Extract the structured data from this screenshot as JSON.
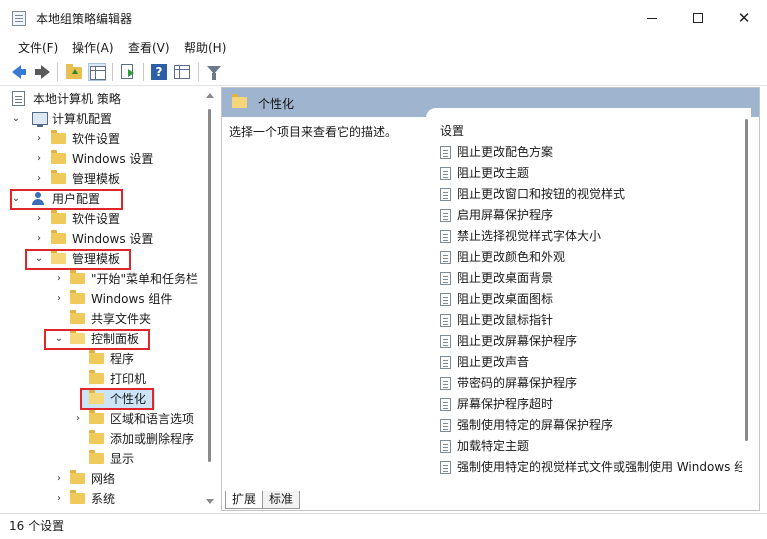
{
  "window": {
    "title": "本地组策略编辑器",
    "minimize_glyph": "—",
    "maximize_glyph": "□",
    "close_glyph": "✕"
  },
  "menu": {
    "items": [
      "文件(F)",
      "操作(A)",
      "查看(V)",
      "帮助(H)"
    ]
  },
  "toolbar": {
    "icons": [
      "back-icon",
      "forward-icon",
      "up-folder-icon",
      "show-hide-tree-icon",
      "export-list-icon",
      "help-icon",
      "properties-icon",
      "filter-icon"
    ]
  },
  "tree": {
    "root": "本地计算机 策略",
    "computer_config": "计算机配置",
    "c_software": "软件设置",
    "c_windows": "Windows 设置",
    "c_admin": "管理模板",
    "user_config": "用户配置",
    "u_software": "软件设置",
    "u_windows": "Windows 设置",
    "u_admin": "管理模板",
    "start_menu": "\"开始\"菜单和任务栏",
    "win_components": "Windows 组件",
    "shared_folders": "共享文件夹",
    "control_panel": "控制面板",
    "programs": "程序",
    "printers": "打印机",
    "personalization": "个性化",
    "region_lang": "区域和语言选项",
    "add_remove": "添加或删除程序",
    "display": "显示",
    "network": "网络",
    "system": "系统"
  },
  "right_pane": {
    "header": "个性化",
    "description": "选择一个项目来查看它的描述。",
    "list_header": "设置",
    "settings": [
      "阻止更改配色方案",
      "阻止更改主题",
      "阻止更改窗口和按钮的视觉样式",
      "启用屏幕保护程序",
      "禁止选择视觉样式字体大小",
      "阻止更改颜色和外观",
      "阻止更改桌面背景",
      "阻止更改桌面图标",
      "阻止更改鼠标指针",
      "阻止更改屏幕保护程序",
      "阻止更改声音",
      "带密码的屏幕保护程序",
      "屏幕保护程序超时",
      "强制使用特定的屏幕保护程序",
      "加载特定主题",
      "强制使用特定的视觉样式文件或强制使用 Windows 经典"
    ],
    "tabs": [
      "扩展",
      "标准"
    ]
  },
  "status": {
    "text": "16 个设置"
  },
  "colors": {
    "header_bg": "#9fb5cf",
    "selection_bg": "#cce4f7",
    "highlight_box": "#e0262b",
    "folder": "#f0c95b"
  }
}
